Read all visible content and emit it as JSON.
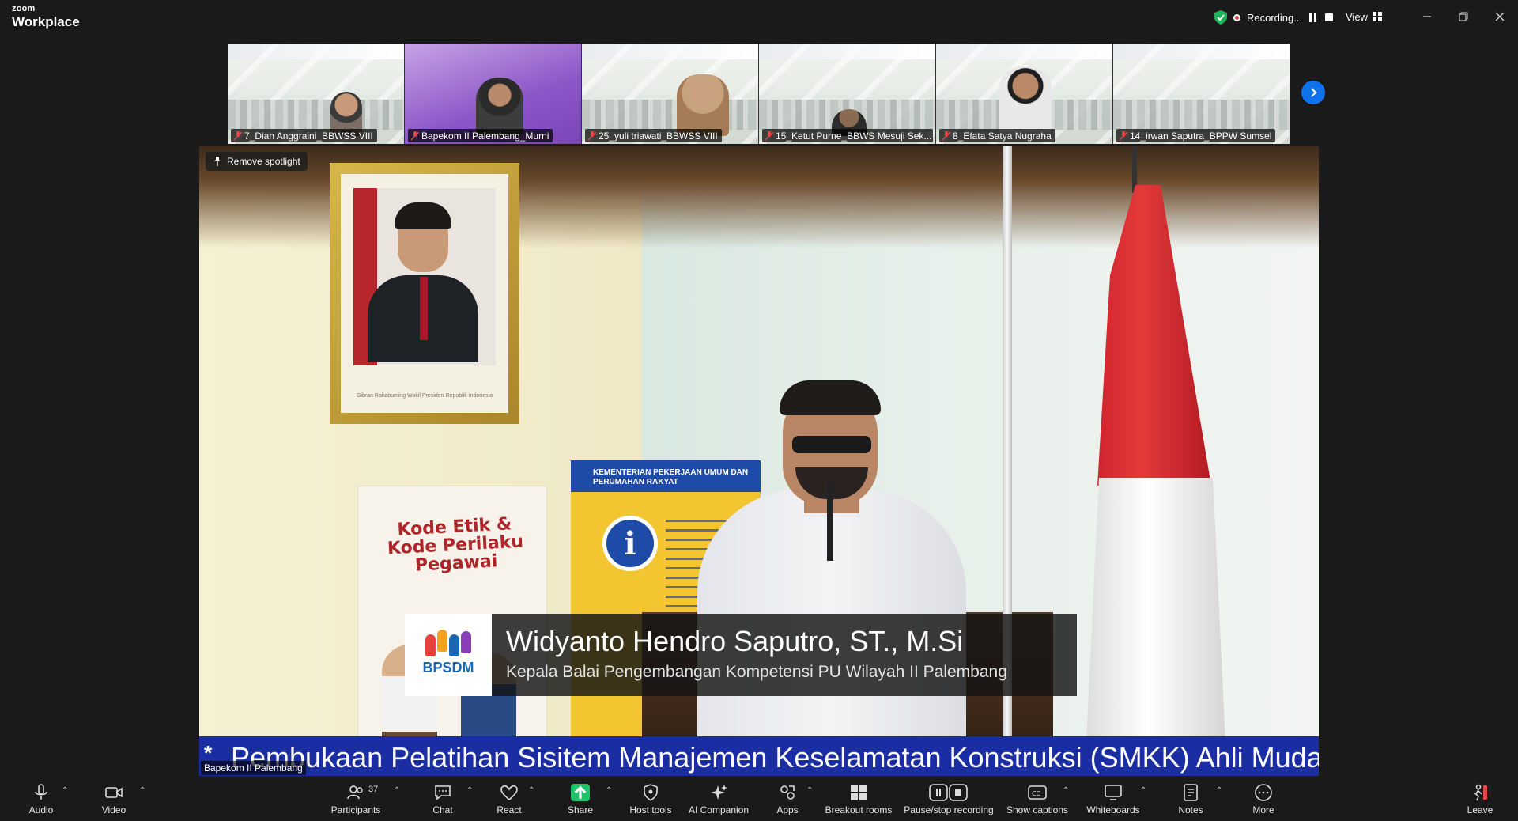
{
  "app": {
    "brand_small": "zoom",
    "brand_large": "Workplace"
  },
  "titlebar": {
    "recording_label": "Recording...",
    "view_label": "View"
  },
  "thumbnails": [
    {
      "name": "7_Dian Anggraini_BBWSS VIII"
    },
    {
      "name": "Bapekom II Palembang_Murni"
    },
    {
      "name": "25_yuli triawati_BBWSS VIII"
    },
    {
      "name": "15_Ketut Purne_BBWS Mesuji Sek..."
    },
    {
      "name": "8_Efata Satya Nugraha"
    },
    {
      "name": "14_irwan Saputra_BPPW Sumsel"
    }
  ],
  "video": {
    "remove_spotlight": "Remove spotlight",
    "speaker_name": "Bapekom II Palembang",
    "frame_caption": "Gibran Rakabuming Wakil Presiden Republik Indonesia",
    "banner_kode": "Kode Etik & Kode Perilaku Pegawai",
    "banner_pu": "KEMENTERIAN PEKERJAAN UMUM DAN PERUMAHAN RAKYAT",
    "lower_third": {
      "logo_text": "BPSDM",
      "name": "Widyanto Hendro Saputro, ST., M.Si",
      "title": "Kepala Balai Pengembangan Kompetensi PU Wilayah II Palembang"
    },
    "ticker_star": "*",
    "ticker_text": "Pembukaan Pelatihan Sisitem Manajemen Keselamatan Konstruksi (SMKK) Ahli Muda"
  },
  "toolbar": {
    "audio": "Audio",
    "video": "Video",
    "participants": "Participants",
    "participants_count": "37",
    "chat": "Chat",
    "react": "React",
    "share": "Share",
    "host_tools": "Host tools",
    "ai_companion": "AI Companion",
    "apps": "Apps",
    "breakout_rooms": "Breakout rooms",
    "pause_stop_recording": "Pause/stop recording",
    "show_captions": "Show captions",
    "whiteboards": "Whiteboards",
    "notes": "Notes",
    "more": "More",
    "leave": "Leave"
  },
  "colors": {
    "accent": "#0e72ed",
    "share_green": "#22c26a",
    "record_red": "#e84545",
    "ticker_blue": "#1b2da3"
  }
}
